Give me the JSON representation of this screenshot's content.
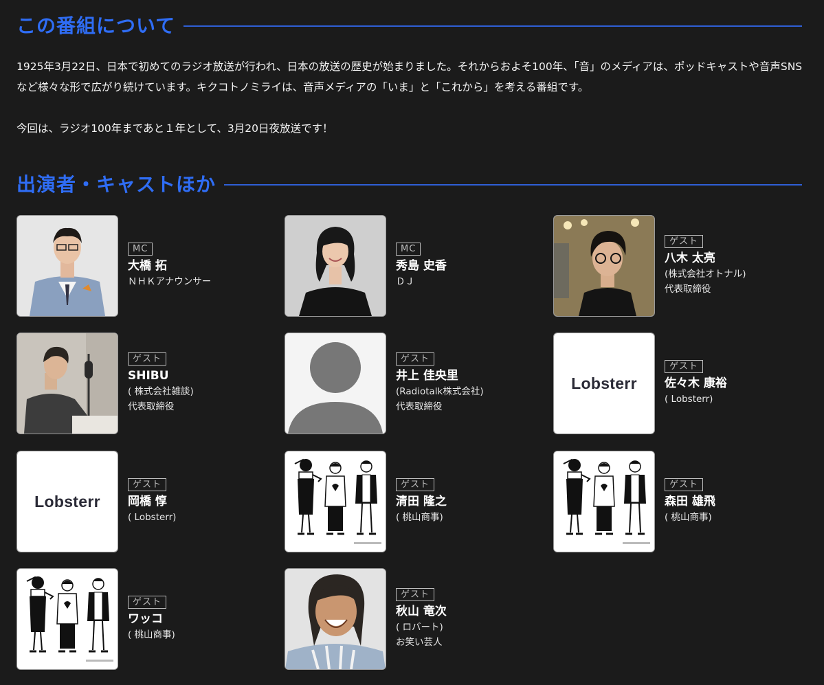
{
  "about": {
    "title": "この番組について",
    "paragraph1": "1925年3月22日、日本で初めてのラジオ放送が行われ、日本の放送の歴史が始まりました。それからおよそ100年、「音」のメディアは、ポッドキャストや音声SNSなど様々な形で広がり続けています。キクコトノミライは、音声メディアの「いま」と「これから」を考える番組です。",
    "paragraph2": "今回は、ラジオ100年まであと１年として、3月20日夜放送です！"
  },
  "cast": {
    "title": "出演者・キャストほか",
    "members": [
      {
        "role": "MC",
        "name": "大橋 拓",
        "lines": [
          "ＮＨＫアナウンサー"
        ],
        "photo": "man-in-suit-photo"
      },
      {
        "role": "MC",
        "name": "秀島 史香",
        "lines": [
          "ＤＪ"
        ],
        "photo": "woman-smiling-photo"
      },
      {
        "role": "ゲスト",
        "name": "八木 太亮",
        "lines": [
          "(株式会社オトナル)",
          "代表取締役"
        ],
        "photo": "man-with-glasses-photo"
      },
      {
        "role": "ゲスト",
        "name": "SHIBU",
        "lines": [
          "( 株式会社雑談)",
          "代表取締役"
        ],
        "photo": "man-at-microphone-photo"
      },
      {
        "role": "ゲスト",
        "name": "井上 佳央里",
        "lines": [
          "(Radiotalk株式会社)",
          "代表取締役"
        ],
        "photo": "person-placeholder-icon"
      },
      {
        "role": "ゲスト",
        "name": "佐々木 康裕",
        "lines": [
          "( Lobsterr)"
        ],
        "logo": "Lobsterr"
      },
      {
        "role": "ゲスト",
        "name": "岡橋 惇",
        "lines": [
          "( Lobsterr)"
        ],
        "logo": "Lobsterr"
      },
      {
        "role": "ゲスト",
        "name": "清田 隆之",
        "lines": [
          "( 桃山商事)"
        ],
        "photo": "trio-illustration"
      },
      {
        "role": "ゲスト",
        "name": "森田 雄飛",
        "lines": [
          "( 桃山商事)"
        ],
        "photo": "trio-illustration"
      },
      {
        "role": "ゲスト",
        "name": "ワッコ",
        "lines": [
          "( 桃山商事)"
        ],
        "photo": "trio-illustration"
      },
      {
        "role": "ゲスト",
        "name": "秋山 竜次",
        "lines": [
          "( ロバート)",
          "お笑い芸人"
        ],
        "photo": "long-hair-man-photo"
      }
    ]
  }
}
